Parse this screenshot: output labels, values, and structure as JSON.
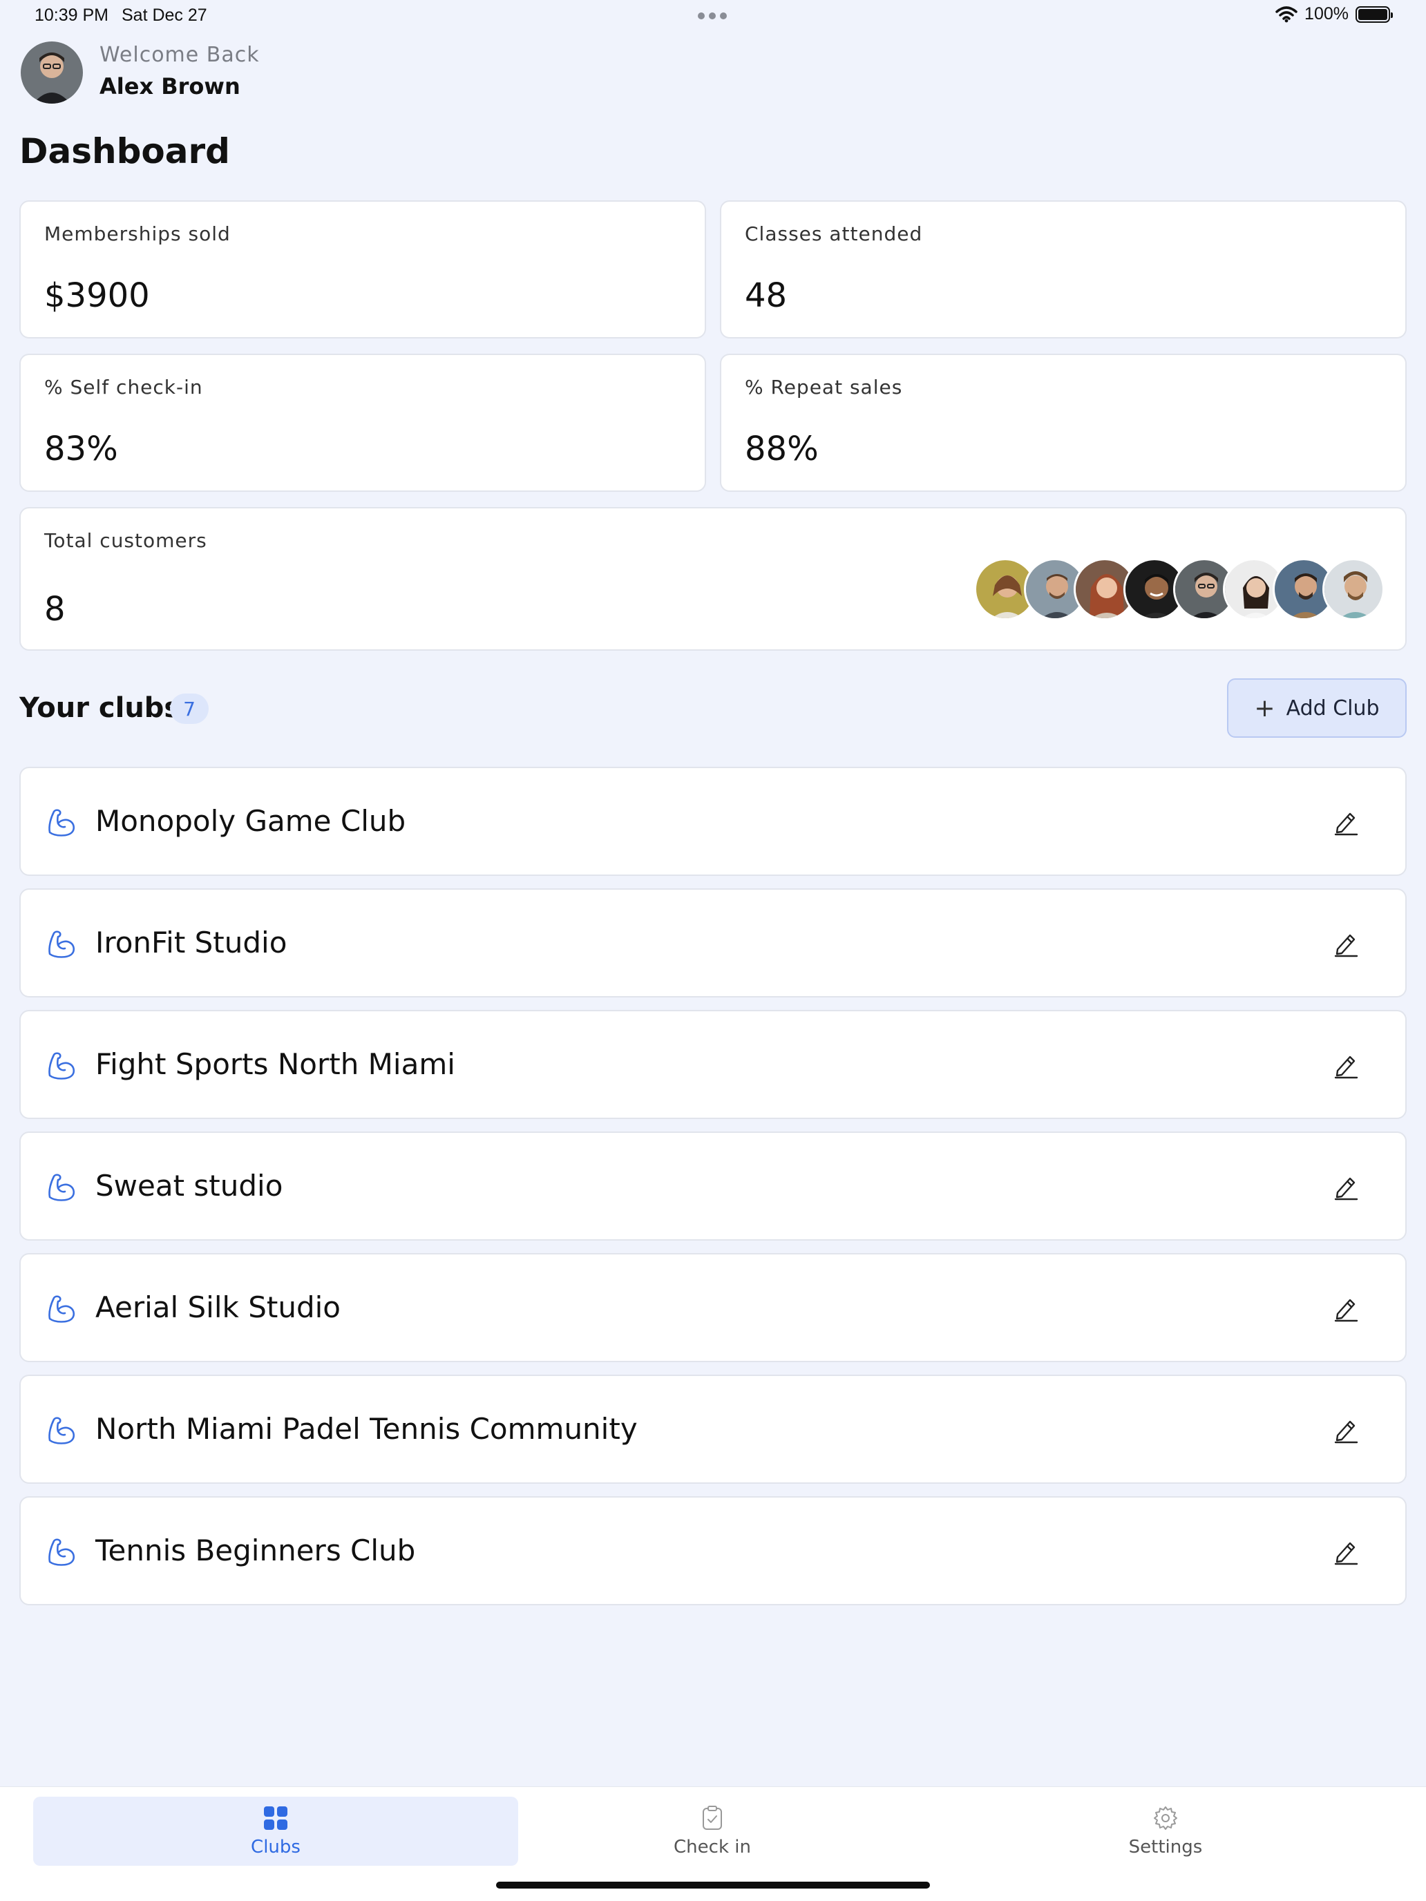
{
  "status_bar": {
    "time": "10:39 PM",
    "date": "Sat Dec 27",
    "battery": "100%"
  },
  "header": {
    "welcome": "Welcome Back",
    "user_name": "Alex Brown"
  },
  "page_title": "Dashboard",
  "stats": {
    "memberships_sold": {
      "label": "Memberships sold",
      "value": "$3900"
    },
    "classes_attended": {
      "label": "Classes attended",
      "value": "48"
    },
    "self_checkin": {
      "label": "% Self check-in",
      "value": "83%"
    },
    "repeat_sales": {
      "label": "% Repeat sales",
      "value": "88%"
    },
    "total_customers": {
      "label": "Total customers",
      "value": "8"
    }
  },
  "clubs": {
    "title": "Your clubs",
    "count": "7",
    "add_label": "Add Club",
    "items": [
      {
        "name": "Monopoly Game Club"
      },
      {
        "name": "IronFit Studio"
      },
      {
        "name": "Fight Sports North Miami"
      },
      {
        "name": "Sweat studio"
      },
      {
        "name": "Aerial Silk Studio"
      },
      {
        "name": "North Miami Padel Tennis Community"
      },
      {
        "name": "Tennis Beginners Club"
      }
    ]
  },
  "nav": {
    "clubs": "Clubs",
    "checkin": "Check in",
    "settings": "Settings"
  },
  "colors": {
    "accent": "#2f6ae2",
    "background": "#f0f3fc",
    "badge_bg": "#dde6fb"
  }
}
